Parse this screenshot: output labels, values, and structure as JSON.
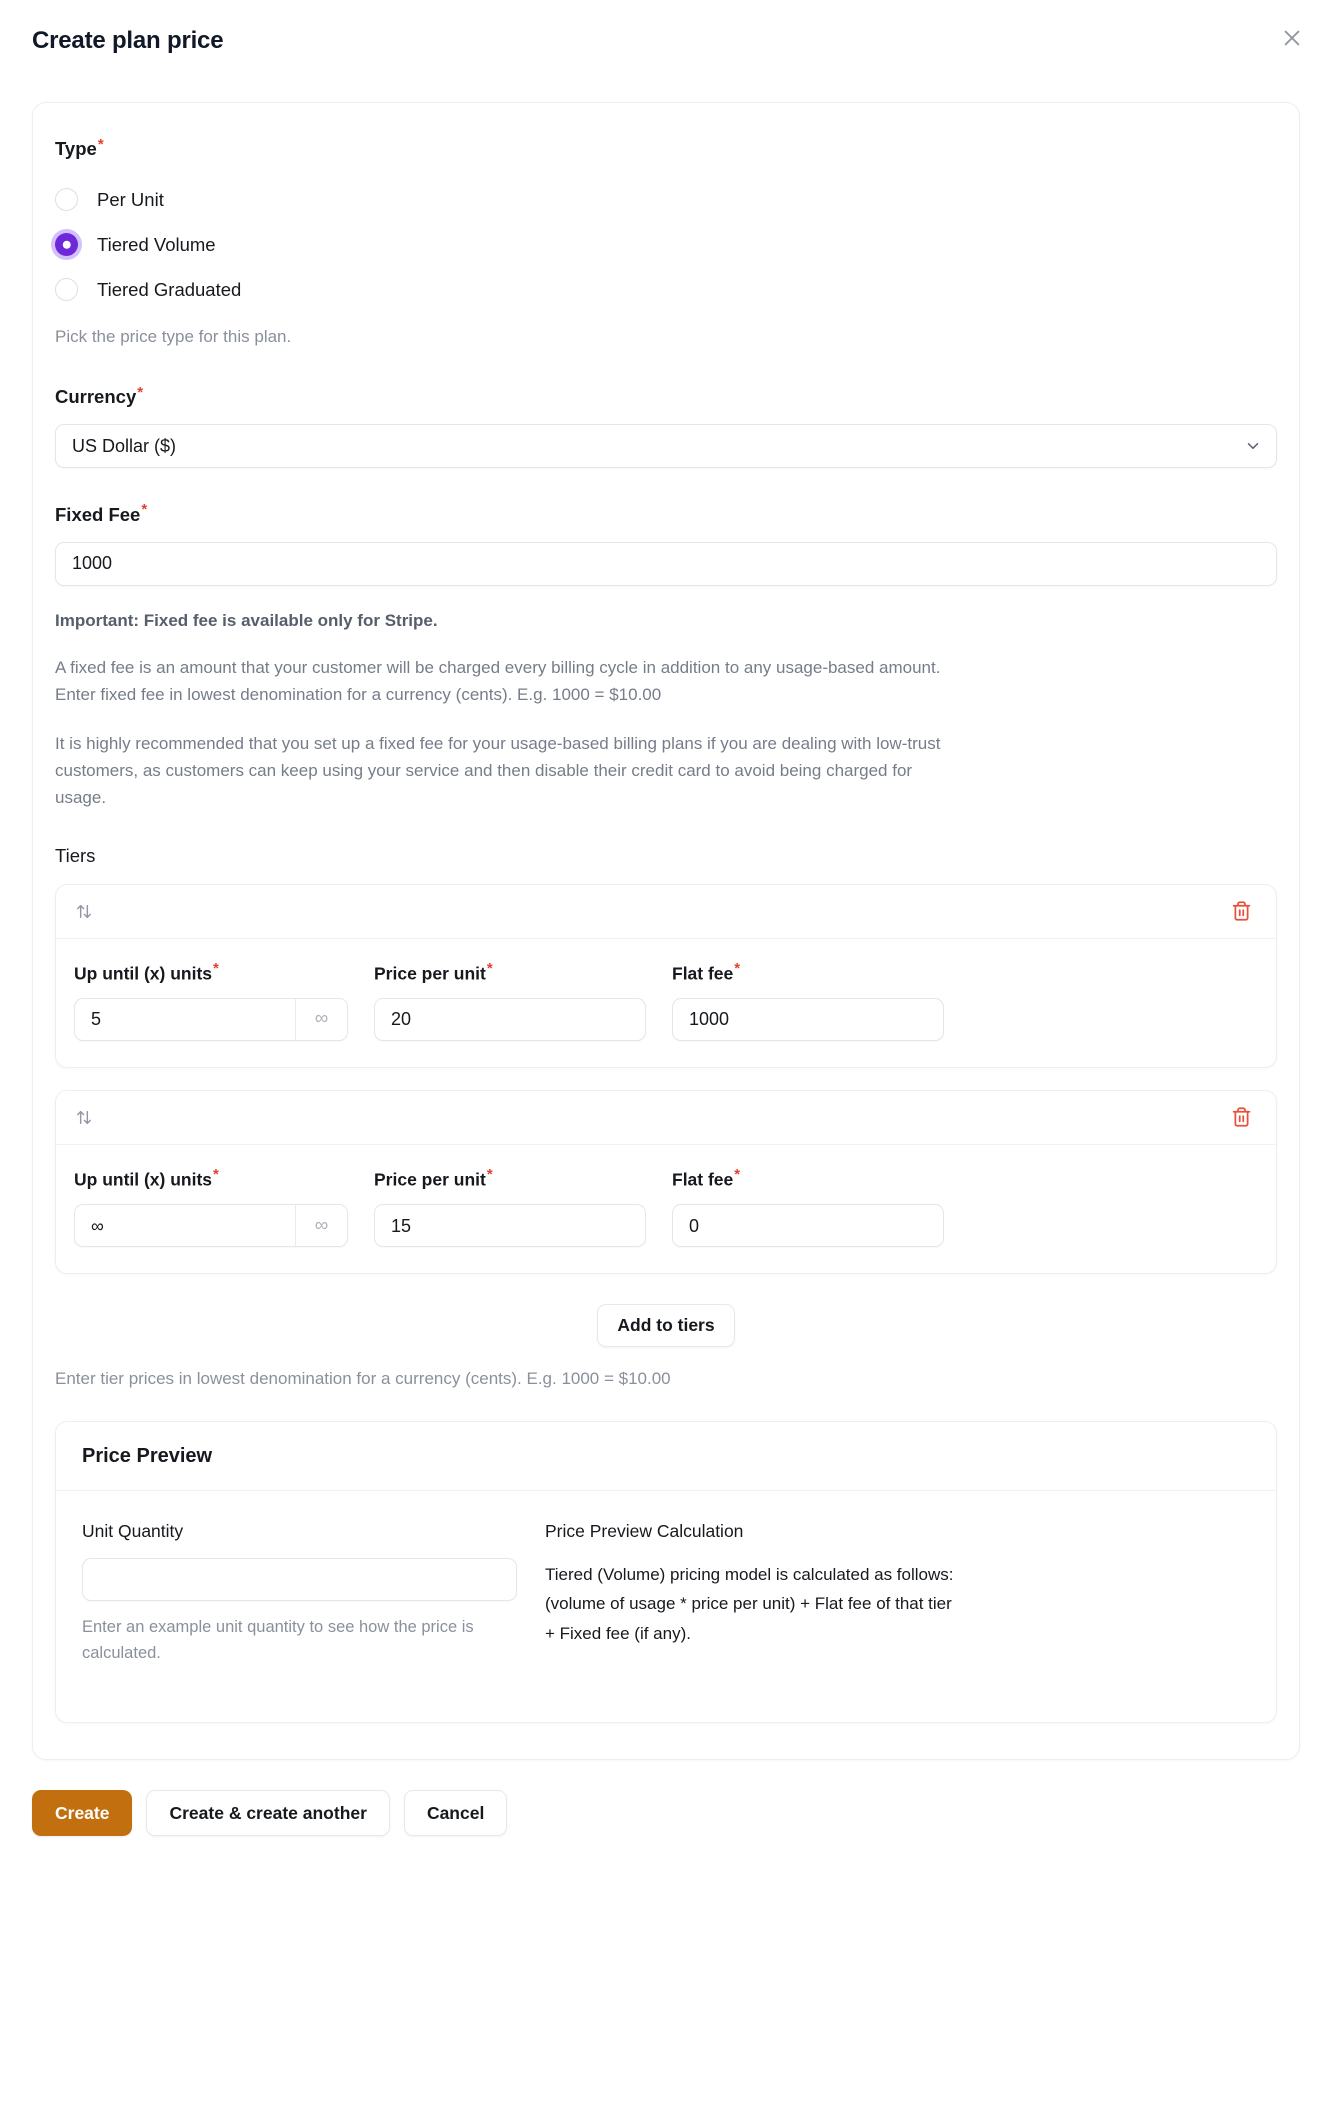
{
  "header": {
    "title": "Create plan price",
    "close_icon": "close-icon"
  },
  "type_field": {
    "label": "Type",
    "required_marker": "*",
    "options": [
      {
        "label": "Per Unit",
        "selected": false
      },
      {
        "label": "Tiered Volume",
        "selected": true
      },
      {
        "label": "Tiered Graduated",
        "selected": false
      }
    ],
    "helper": "Pick the price type for this plan."
  },
  "currency_field": {
    "label": "Currency",
    "required_marker": "*",
    "value": "US Dollar ($)",
    "chevron_icon": "chevron-down-icon"
  },
  "fixed_fee_field": {
    "label": "Fixed Fee",
    "required_marker": "*",
    "value": "1000",
    "note_bold": "Important: Fixed fee is available only for Stripe.",
    "note_1": "A fixed fee is an amount that your customer will be charged every billing cycle in addition to any usage-based amount. Enter fixed fee in lowest denomination for a currency (cents). E.g. 1000 = $10.00",
    "note_2": "It is highly recommended that you set up a fixed fee for your usage-based billing plans if you are dealing with low-trust customers, as customers can keep using your service and then disable their credit card to avoid being charged for usage."
  },
  "tiers": {
    "label": "Tiers",
    "column_labels": {
      "up_until": "Up until (x) units",
      "price_per_unit": "Price per unit",
      "flat_fee": "Flat fee"
    },
    "required_marker": "*",
    "sort_icon": "sort-updown-icon",
    "delete_icon": "trash-icon",
    "infinity_icon": "infinity-icon",
    "infinity_symbol": "∞",
    "rows": [
      {
        "up_until": "5",
        "price_per_unit": "20",
        "flat_fee": "1000"
      },
      {
        "up_until": "∞",
        "price_per_unit": "15",
        "flat_fee": "0"
      }
    ],
    "add_button": "Add to tiers",
    "helper": "Enter tier prices in lowest denomination for a currency (cents). E.g. 1000 = $10.00"
  },
  "price_preview": {
    "title": "Price Preview",
    "unit_quantity_label": "Unit Quantity",
    "unit_quantity_value": "",
    "unit_quantity_note": "Enter an example unit quantity to see how the price is calculated.",
    "calculation_label": "Price Preview Calculation",
    "calculation_text": "Tiered (Volume) pricing model is calculated as follows: (volume of usage * price per unit) + Flat fee of that tier + Fixed fee (if any)."
  },
  "footer": {
    "create": "Create",
    "create_another": "Create & create another",
    "cancel": "Cancel"
  },
  "colors": {
    "accent_primary": "#c2700f",
    "radio_selected": "#6d28d9",
    "required_star": "#e0402f",
    "delete_icon": "#e8503a"
  }
}
